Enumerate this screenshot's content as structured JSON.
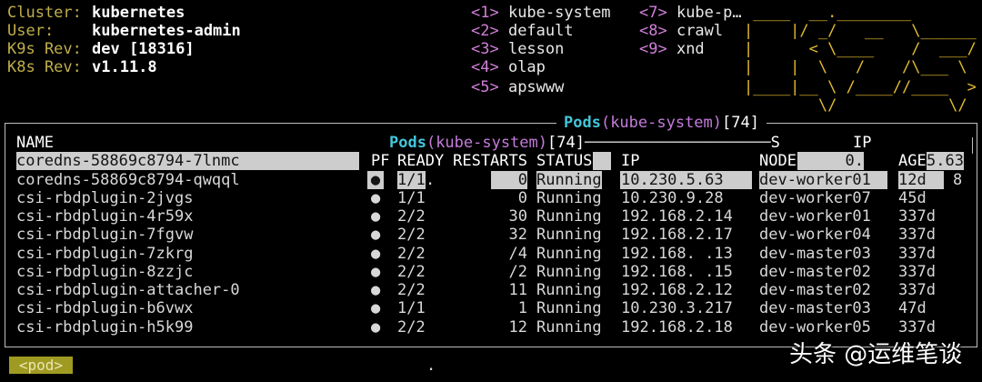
{
  "info": [
    {
      "label": "Cluster:",
      "value": "kubernetes"
    },
    {
      "label": "User:",
      "value": "kubernetes-admin"
    },
    {
      "label": "K9s Rev:",
      "value": "dev [18316]"
    },
    {
      "label": "K8s Rev:",
      "value": "v1.11.8"
    }
  ],
  "namespaces": [
    {
      "key": "<1>",
      "name": "kube-system"
    },
    {
      "key": "<2>",
      "name": "default"
    },
    {
      "key": "<3>",
      "name": "lesson"
    },
    {
      "key": "<4>",
      "name": "olap"
    },
    {
      "key": "<5>",
      "name": "apswww"
    },
    {
      "key": "<7>",
      "name": "kube-p…"
    },
    {
      "key": "<8>",
      "name": "crawl"
    },
    {
      "key": "<9>",
      "name": "xnd"
    }
  ],
  "logo_lines": [
    " ____  __.________       ",
    "|    |/ _/   __   \\______",
    "|      < \\____    /  ___/",
    "|    |  \\   /    /\\___ \\ ",
    "|____|__ \\ /____//____  >",
    "        \\/            \\/ "
  ],
  "table": {
    "title": {
      "resource": "Pods",
      "namespace": "(kube-system)",
      "count": "[74]"
    },
    "columns": {
      "name": "NAME",
      "pf": "PF",
      "ready": "READY",
      "restarts": "RESTARTS",
      "status": "STATUS",
      "ip": "IP",
      "node": "NODE",
      "age": "AGE"
    },
    "selected_pod": "coredns-58869c8794-7lnmc",
    "overlay": {
      "rule": "────────────────────",
      "s": "S",
      "ip": "IP",
      "node_fragment": "0.",
      "age_fragment": "5.63",
      "ready_fragment": ".",
      "age_tail": "8"
    },
    "rows": [
      {
        "name": "coredns-58869c8794-qwqql",
        "pf": "●",
        "ready": "1/1",
        "restarts": "0",
        "status": "Running",
        "ip": "10.230.5.63",
        "node": "dev-worker01",
        "age": "12d"
      },
      {
        "name": "csi-rbdplugin-2jvgs",
        "pf": "●",
        "ready": "1/1",
        "restarts": "0",
        "status": "Running",
        "ip": "10.230.9.28",
        "node": "dev-worker07",
        "age": "45d"
      },
      {
        "name": "csi-rbdplugin-4r59x",
        "pf": "●",
        "ready": "2/2",
        "restarts": "30",
        "status": "Running",
        "ip": "192.168.2.14",
        "node": "dev-worker01",
        "age": "337d"
      },
      {
        "name": "csi-rbdplugin-7fgvw",
        "pf": "●",
        "ready": "2/2",
        "restarts": "32",
        "status": "Running",
        "ip": "192.168.2.17",
        "node": "dev-worker04",
        "age": "337d"
      },
      {
        "name": "csi-rbdplugin-7zkrg",
        "pf": "●",
        "ready": "2/2",
        "restarts": "/4",
        "status": "Running",
        "ip": "192.168. .13",
        "node": "dev-master03",
        "age": "337d"
      },
      {
        "name": "csi-rbdplugin-8zzjc",
        "pf": "●",
        "ready": "2/2",
        "restarts": "/2",
        "status": "Running",
        "ip": "192.168. .15",
        "node": "dev-master02",
        "age": "337d"
      },
      {
        "name": "csi-rbdplugin-attacher-0",
        "pf": "●",
        "ready": "2/2",
        "restarts": "11",
        "status": "Running",
        "ip": "192.168.2.12",
        "node": "dev-master02",
        "age": "337d"
      },
      {
        "name": "csi-rbdplugin-b6vwx",
        "pf": "●",
        "ready": "1/1",
        "restarts": "1",
        "status": "Running",
        "ip": "10.230.3.217",
        "node": "dev-master03",
        "age": "47d"
      },
      {
        "name": "csi-rbdplugin-h5k99",
        "pf": "●",
        "ready": "2/2",
        "restarts": "12",
        "status": "Running",
        "ip": "192.168.2.18",
        "node": "dev-worker05",
        "age": "337d"
      }
    ]
  },
  "footer": {
    "crumb": "<pod>",
    "dot": "."
  },
  "watermark": "头条 @运维笔谈",
  "colors": {
    "background": "#000000",
    "info_label": "#bfae4a",
    "hotkey": "#d17fd9",
    "logo": "#e0b930",
    "title_resource": "#43c6db",
    "title_namespace": "#c57bdb",
    "selection": "#cdcdcd",
    "crumb": "#9f9a22"
  }
}
